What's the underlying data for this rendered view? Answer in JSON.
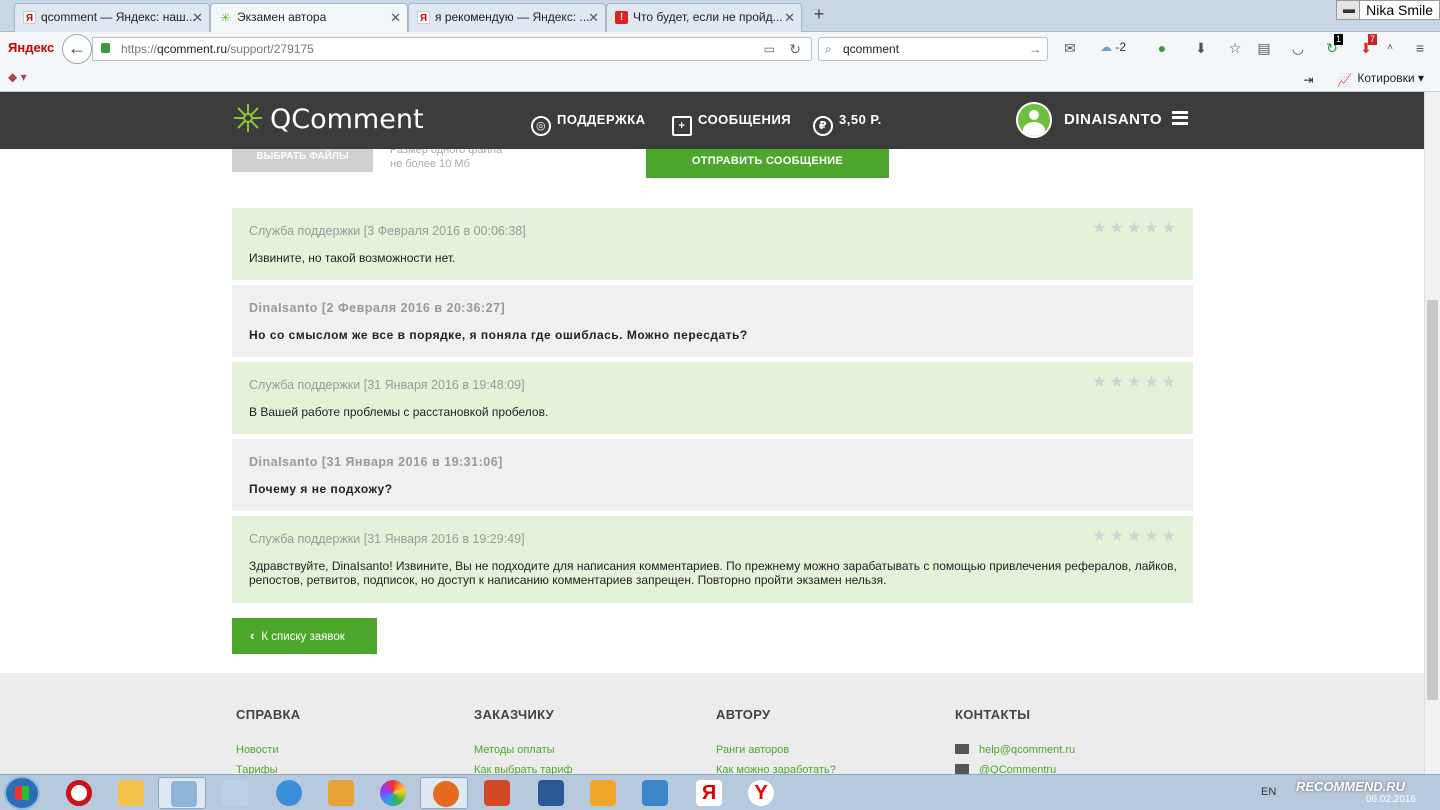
{
  "browser": {
    "tabs": [
      {
        "label": "qcomment — Яндекс: наш...",
        "icon": "yandex-icon"
      },
      {
        "label": "Экзамен автора",
        "icon": "qcomment-icon"
      },
      {
        "label": "я рекомендую — Яндекс: ...",
        "icon": "yandex-icon"
      },
      {
        "label": "Что будет, если не пройд...",
        "icon": "red-site-icon"
      }
    ],
    "user_badge": "Nika Smile",
    "yandex_label": "Яндекс",
    "url_prefix": "https://",
    "url_domain": "qcomment.ru",
    "url_path": "/support/279175",
    "search_value": "qcomment",
    "weather": "-2",
    "badge_1": "1",
    "badge_2": "7",
    "bookmark_right": "Котировки"
  },
  "site": {
    "logo": "QComment",
    "nav": {
      "support": "ПОДДЕРЖКА",
      "messages": "СООБЩЕНИЯ",
      "balance": "3,50 Р."
    },
    "username": "DINAISANTO"
  },
  "form": {
    "choose_files": "ВЫБРАТЬ ФАЙЛЫ",
    "file_hint_1": "Размер одного файла",
    "file_hint_2": "не более 10 Мб",
    "send": "ОТПРАВИТЬ СООБЩЕНИЕ"
  },
  "messages": [
    {
      "author": "Служба поддержки",
      "date": "[3 Февраля 2016 в 00:06:38]",
      "text": "Извините, но такой возможности нет.",
      "type": "support"
    },
    {
      "author": "DinaIsanto",
      "date": "[2 Февраля 2016 в 20:36:27]",
      "text": "Но со смыслом же все в порядке, я поняла где ошиблась. Можно пересдать?",
      "type": "user"
    },
    {
      "author": "Служба поддержки",
      "date": "[31 Января 2016 в 19:48:09]",
      "text": "В Вашей работе проблемы с расстановкой пробелов.",
      "type": "support"
    },
    {
      "author": "DinaIsanto",
      "date": "[31 Января 2016 в 19:31:06]",
      "text": "Почему я не подхожу?",
      "type": "user"
    },
    {
      "author": "Служба поддержки",
      "date": "[31 Января 2016 в 19:29:49]",
      "text": "Здравствуйте, DinaIsanto! Извините, Вы не подходите для написания комментариев. По прежнему можно зарабатывать с помощью привлечения рефералов, лайков, репостов, ретвитов, подписок, но доступ к написанию комментариев запрещен. Повторно пройти экзамен нельзя.",
      "type": "support"
    }
  ],
  "back_to_list": "К списку заявок",
  "footer": {
    "col1": {
      "title": "СПРАВКА",
      "link1": "Новости",
      "link2": "Тарифы"
    },
    "col2": {
      "title": "ЗАКАЗЧИКУ",
      "link1": "Методы оплаты",
      "link2": "Как выбрать тариф"
    },
    "col3": {
      "title": "АВТОРУ",
      "link1": "Ранги авторов",
      "link2": "Как можно заработать?"
    },
    "col4": {
      "title": "КОНТАКТЫ",
      "link1": "help@qcomment.ru",
      "link2": "@QCommentru"
    }
  },
  "taskbar": {
    "lang": "EN",
    "watermark": "RECOMMEND.RU",
    "date": "06.02.2016"
  },
  "colors": {
    "accent": "#4da62c",
    "support_bg": "#e4f2da",
    "user_bg": "#f0f0f0",
    "header_bg": "#3c3c3c"
  }
}
